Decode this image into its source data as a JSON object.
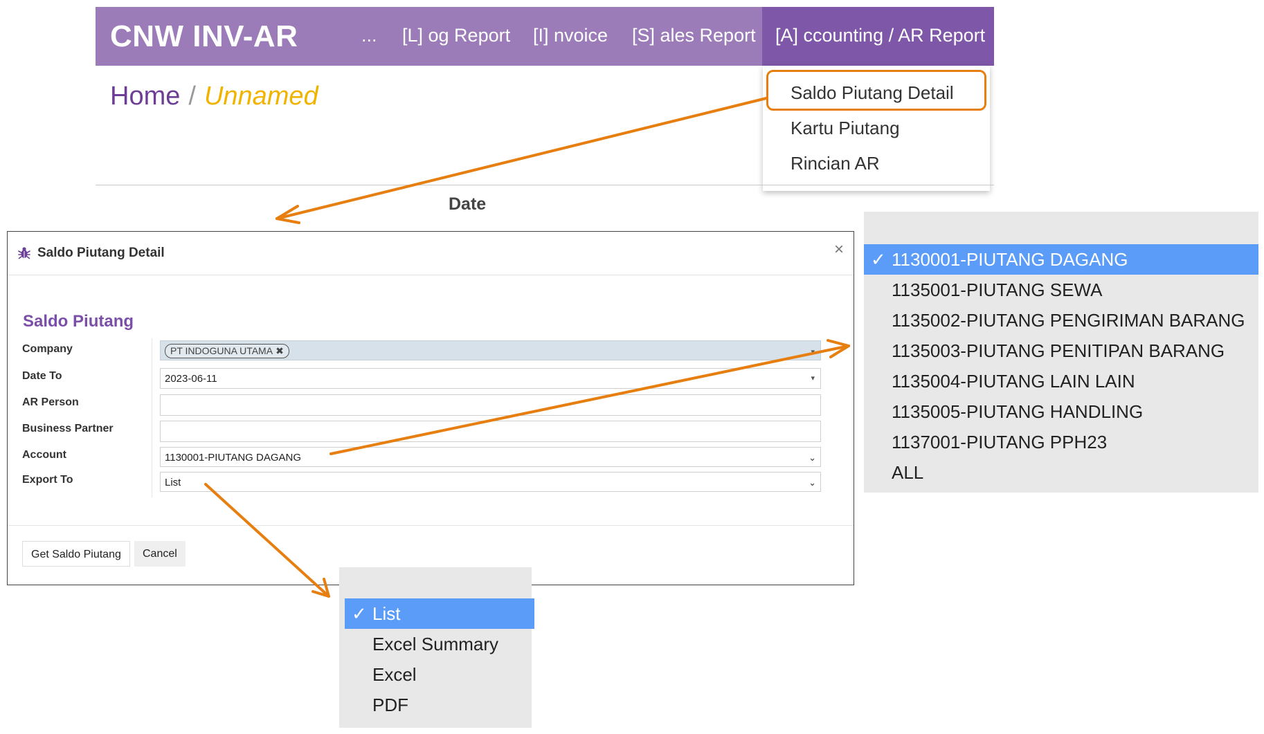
{
  "navbar": {
    "brand": "CNW INV-AR",
    "items": [
      {
        "label": "..."
      },
      {
        "label": "[L] og Report"
      },
      {
        "label": "[I] nvoice"
      },
      {
        "label": "[S] ales Report"
      },
      {
        "label": "[A] ccounting / AR Report"
      }
    ],
    "active_index": 4
  },
  "accounting_menu": {
    "items": [
      {
        "label": "Saldo Piutang Detail"
      },
      {
        "label": "Kartu Piutang"
      },
      {
        "label": "Rincian AR"
      }
    ],
    "highlighted_index": 0
  },
  "breadcrumb": {
    "home": "Home",
    "separator": "/",
    "current": "Unnamed"
  },
  "table_header": {
    "date": "Date"
  },
  "modal": {
    "title": "Saldo Piutang Detail",
    "close_symbol": "×",
    "section_title": "Saldo Piutang",
    "fields": {
      "company": {
        "label": "Company",
        "tag": "PT INDOGUNA UTAMA"
      },
      "date_to": {
        "label": "Date To",
        "value": "2023-06-11"
      },
      "ar_person": {
        "label": "AR Person",
        "value": ""
      },
      "business_partner": {
        "label": "Business Partner",
        "value": ""
      },
      "account": {
        "label": "Account",
        "value": "1130001-PIUTANG DAGANG"
      },
      "export_to": {
        "label": "Export To",
        "value": "List"
      }
    },
    "buttons": {
      "get": "Get Saldo Piutang",
      "cancel": "Cancel"
    }
  },
  "account_options": {
    "selected_index": 0,
    "items": [
      {
        "label": "1130001-PIUTANG DAGANG"
      },
      {
        "label": "1135001-PIUTANG SEWA"
      },
      {
        "label": "1135002-PIUTANG PENGIRIMAN BARANG"
      },
      {
        "label": "1135003-PIUTANG PENITIPAN BARANG"
      },
      {
        "label": "1135004-PIUTANG LAIN LAIN"
      },
      {
        "label": "1135005-PIUTANG HANDLING"
      },
      {
        "label": "1137001-PIUTANG PPH23"
      },
      {
        "label": "ALL"
      }
    ]
  },
  "export_options": {
    "selected_index": 0,
    "items": [
      {
        "label": "List"
      },
      {
        "label": "Excel Summary"
      },
      {
        "label": "Excel"
      },
      {
        "label": "PDF"
      }
    ]
  },
  "colors": {
    "navbar": "#9b7bb8",
    "navbar_active": "#7e57a8",
    "annotation_arrow": "#e67e10",
    "breadcrumb_current": "#f0b400",
    "section_title": "#7b4fa8",
    "selected_option": "#5a9cf8"
  },
  "icons": {
    "modal_title_icon": "bug-icon",
    "check": "checkmark-icon"
  }
}
